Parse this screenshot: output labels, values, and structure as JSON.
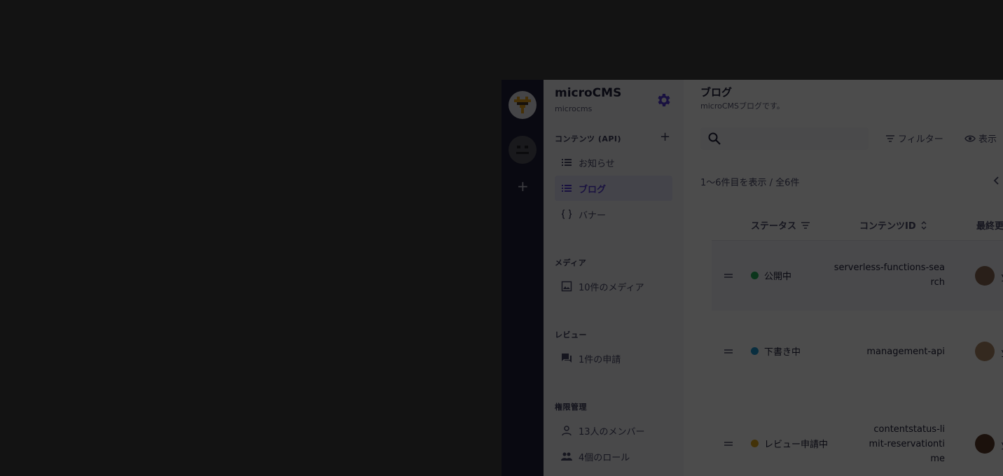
{
  "sidebar": {
    "service_name": "microCMS",
    "service_id": "microcms",
    "sections": {
      "contents": "コンテンツ (API)",
      "media": "メディア",
      "review": "レビュー",
      "permissions": "権限管理"
    },
    "items": [
      {
        "label": "お知らせ",
        "icon": "list-icon"
      },
      {
        "label": "ブログ",
        "icon": "list-icon",
        "active": true
      },
      {
        "label": "バナー",
        "icon": "braces-icon"
      },
      {
        "label": "10件のメディア",
        "icon": "image-icon"
      },
      {
        "label": "1件の申請",
        "icon": "chat-icon"
      },
      {
        "label": "13人のメンバー",
        "icon": "person-icon"
      },
      {
        "label": "4個のロール",
        "icon": "people-icon"
      }
    ]
  },
  "main": {
    "title": "ブログ",
    "description": "microCMSブログです。",
    "filter_label": "フィルター",
    "view_label": "表示",
    "count_text": "1〜6件目を表示 / 全6件",
    "columns": {
      "status": "ステータス",
      "content_id": "コンテンツID",
      "updated": "最終更"
    },
    "rows": [
      {
        "status": "公開中",
        "status_color": "#26b35a",
        "content_id": "serverless-functions-search",
        "author_initial": "ｙ"
      },
      {
        "status": "下書き中",
        "status_color": "#1f9bd4",
        "content_id": "management-api",
        "author_initial": "ｙ"
      },
      {
        "status": "レビュー申請中",
        "status_color": "#e0a81c",
        "content_id": "contentstatus-limit-reservationtime",
        "author_initial": "ｙ"
      }
    ]
  },
  "colors": {
    "accent": "#563bd6",
    "rail": "#21213b",
    "sidebar": "#f3f3f8",
    "overlay": "rgba(0,0,0,0.70)"
  }
}
